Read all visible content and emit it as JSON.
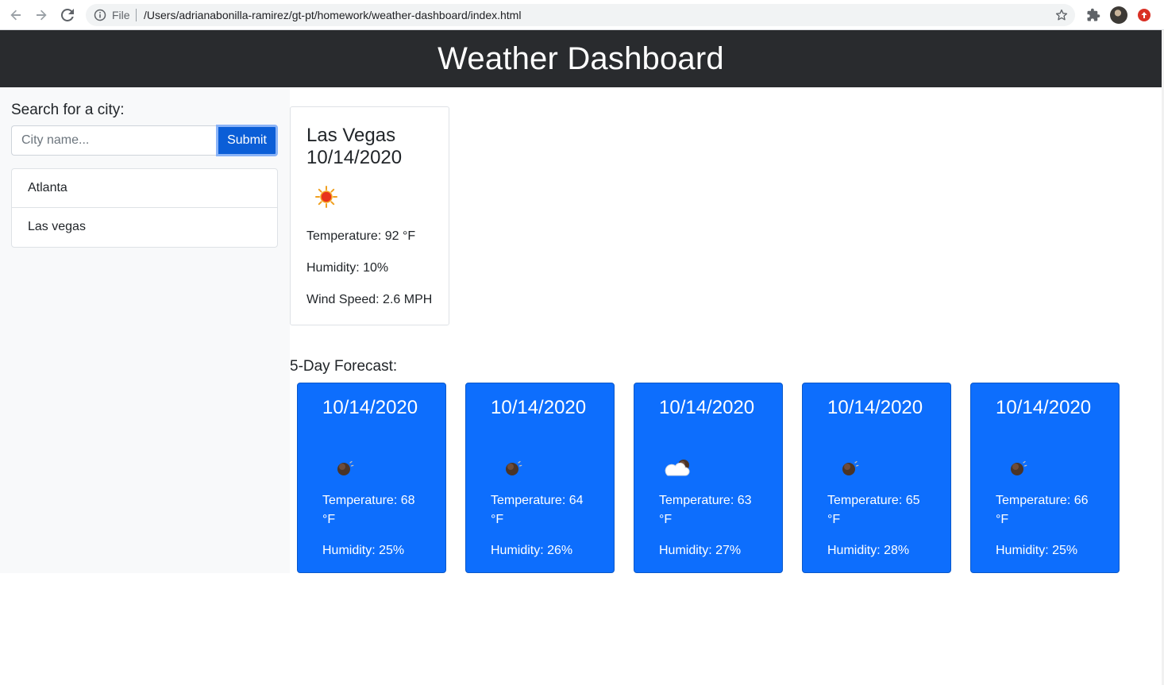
{
  "browser": {
    "scheme_label": "File",
    "url": "/Users/adrianabonilla-ramirez/gt-pt/homework/weather-dashboard/index.html"
  },
  "header": {
    "title": "Weather Dashboard"
  },
  "search": {
    "label": "Search for a city:",
    "placeholder": "City name...",
    "submit_label": "Submit"
  },
  "history": [
    "Atlanta",
    "Las vegas"
  ],
  "current": {
    "title_line1": "Las Vegas",
    "title_line2": "10/14/2020",
    "icon": "clear-day-sun-icon",
    "temperature": "Temperature: 92 °F",
    "humidity": "Humidity: 10%",
    "wind": "Wind Speed: 2.6 MPH"
  },
  "forecast": {
    "heading": "5-Day Forecast:",
    "days": [
      {
        "date": "10/14/2020",
        "icon": "clear-night-icon",
        "temperature": "Temperature: 68 °F",
        "humidity": "Humidity: 25%"
      },
      {
        "date": "10/14/2020",
        "icon": "clear-night-icon",
        "temperature": "Temperature: 64 °F",
        "humidity": "Humidity: 26%"
      },
      {
        "date": "10/14/2020",
        "icon": "partly-cloudy-night-icon",
        "temperature": "Temperature: 63 °F",
        "humidity": "Humidity: 27%"
      },
      {
        "date": "10/14/2020",
        "icon": "clear-night-icon",
        "temperature": "Temperature: 65 °F",
        "humidity": "Humidity: 28%"
      },
      {
        "date": "10/14/2020",
        "icon": "clear-night-icon",
        "temperature": "Temperature: 66 °F",
        "humidity": "Humidity: 25%"
      }
    ]
  },
  "colors": {
    "header_bg": "#292b2e",
    "sidebar_bg": "#f8f9fa",
    "primary": "#0d6efd",
    "submit_bg": "#0b5ed7"
  }
}
